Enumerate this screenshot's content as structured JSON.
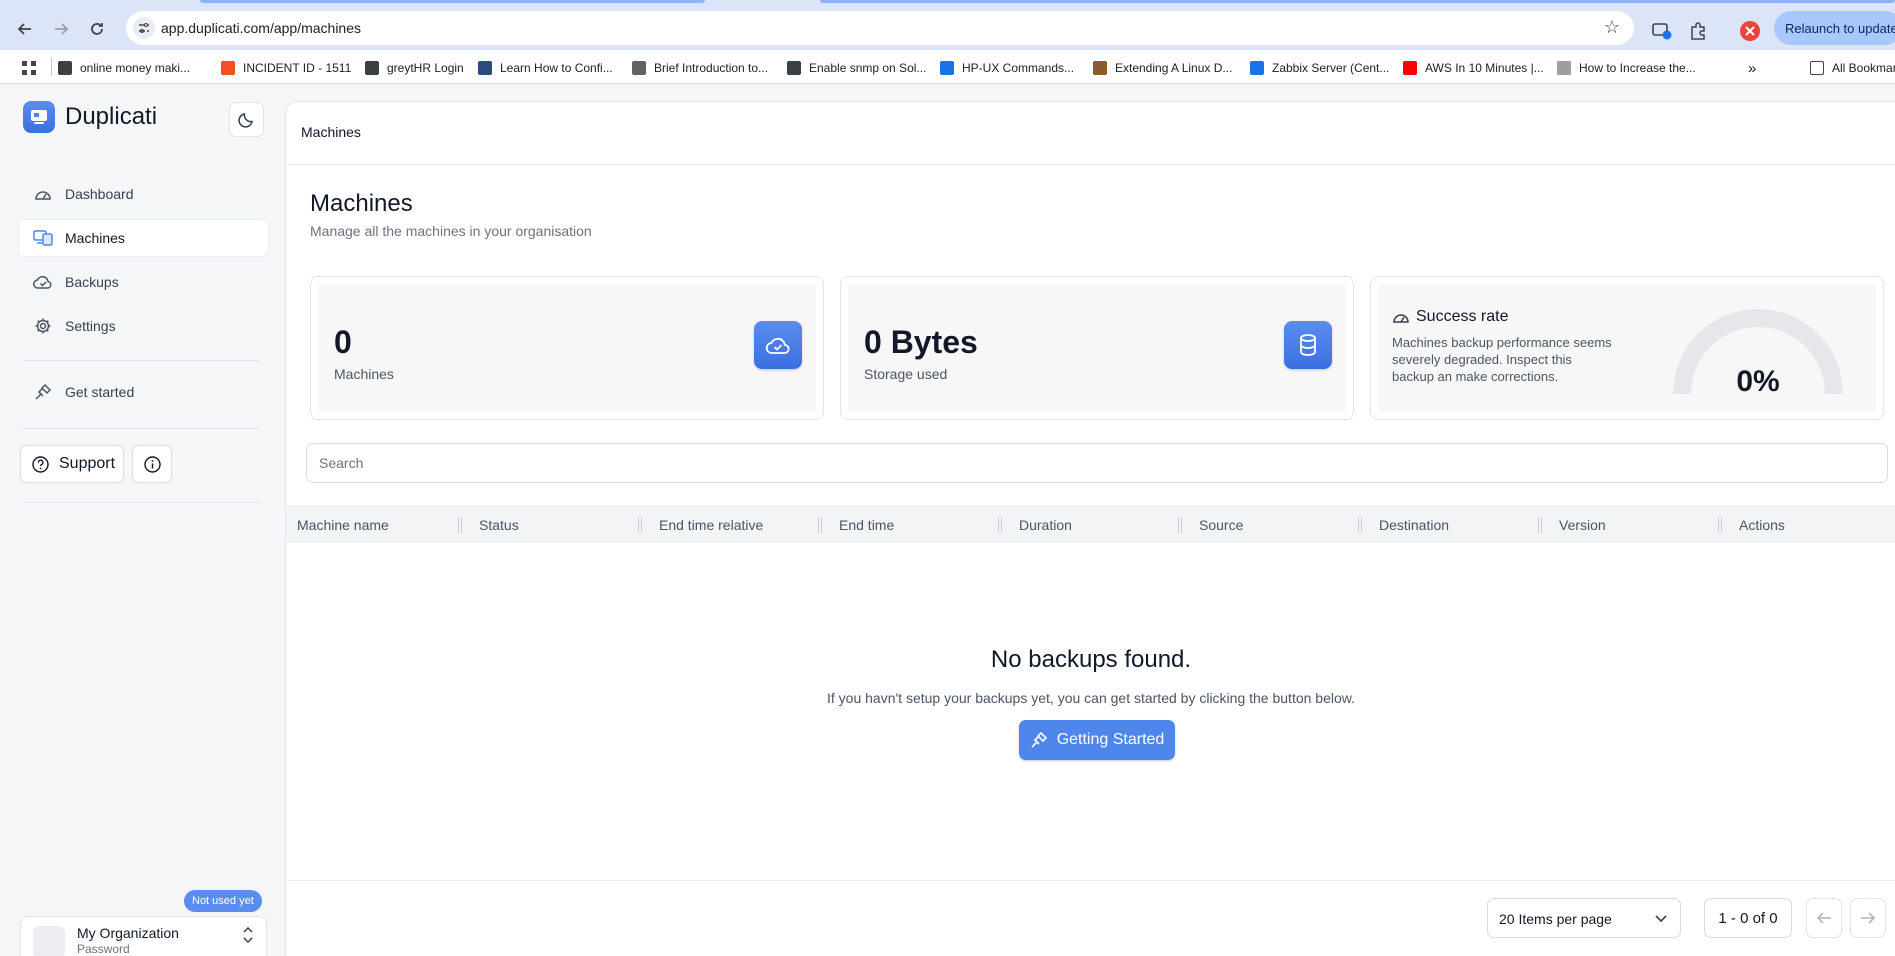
{
  "browser": {
    "url": "app.duplicati.com/app/machines",
    "relaunch_label": "Relaunch to update",
    "more_label": "»",
    "bookmarks": [
      {
        "label": "online money maki...",
        "color": "#3c4043"
      },
      {
        "label": "INCIDENT ID - 1511",
        "color": "#f25022"
      },
      {
        "label": "greytHR Login",
        "color": "#3c4043"
      },
      {
        "label": "Learn How to Confi...",
        "color": "#2c4a7a"
      },
      {
        "label": "Brief Introduction to...",
        "color": "#5f6368"
      },
      {
        "label": "Enable snmp on Sol...",
        "color": "#3c4043"
      },
      {
        "label": "HP-UX Commands...",
        "color": "#1a73e8"
      },
      {
        "label": "Extending A Linux D...",
        "color": "#8b5a2b"
      },
      {
        "label": "Zabbix Server (Cent...",
        "color": "#1a73e8"
      },
      {
        "label": "AWS In 10 Minutes |...",
        "color": "#ff0000"
      },
      {
        "label": "How to Increase the...",
        "color": "#9e9e9e"
      }
    ],
    "all_bookmarks_label": "All Bookmarks"
  },
  "brand": {
    "name": "Duplicati",
    "accent": "#4f86ec"
  },
  "sidebar": {
    "items": [
      {
        "label": "Dashboard",
        "icon": "gauge-icon"
      },
      {
        "label": "Machines",
        "icon": "machines-icon",
        "active": true
      },
      {
        "label": "Backups",
        "icon": "cloud-check-icon"
      },
      {
        "label": "Settings",
        "icon": "gear-icon"
      },
      {
        "label": "Get started",
        "icon": "plug-icon"
      }
    ],
    "support_label": "Support",
    "badge": "Not used yet",
    "org": {
      "name": "My Organization",
      "sub": "Password"
    }
  },
  "breadcrumb": "Machines",
  "page": {
    "title": "Machines",
    "subtitle": "Manage all the machines in your organisation"
  },
  "stats": {
    "machines": {
      "value": "0",
      "label": "Machines"
    },
    "storage": {
      "value": "0 Bytes",
      "label": "Storage used"
    },
    "success": {
      "title": "Success rate",
      "description": "Machines backup performance seems severely degraded. Inspect this backup an make corrections.",
      "value": "0%",
      "fraction": 0
    }
  },
  "search": {
    "placeholder": "Search"
  },
  "table": {
    "columns": [
      "Machine name",
      "Status",
      "End time relative",
      "End time",
      "Duration",
      "Source",
      "Destination",
      "Version",
      "Actions"
    ]
  },
  "empty": {
    "title": "No backups found.",
    "subtitle": "If you havn't setup your backups yet, you can get started by clicking the button below.",
    "button": "Getting Started"
  },
  "pagination": {
    "per_page": "20 Items per page",
    "range": "1 - 0 of 0"
  }
}
